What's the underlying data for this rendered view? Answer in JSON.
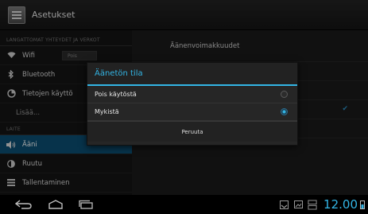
{
  "actionbar": {
    "title": "Asetukset"
  },
  "sidebar": {
    "section_wireless": "LANGATTOMAT YHTEYDET JA VERKOT",
    "items_wireless": [
      {
        "label": "Wifi",
        "icon": "wifi-icon",
        "toggle": "Pois"
      },
      {
        "label": "Bluetooth",
        "icon": "bluetooth-icon"
      },
      {
        "label": "Tietojen käyttö",
        "icon": "data-usage-icon"
      },
      {
        "label": "Lisää...",
        "icon": ""
      }
    ],
    "section_device": "LAITE",
    "items_device": [
      {
        "label": "Ääni",
        "icon": "sound-icon",
        "selected": true
      },
      {
        "label": "Ruutu",
        "icon": "display-icon"
      },
      {
        "label": "Tallentaminen",
        "icon": "storage-icon"
      }
    ]
  },
  "main": {
    "header": "Äänenvoimakkuudet"
  },
  "dialog": {
    "title": "Äänetön tila",
    "options": [
      {
        "label": "Pois käytöstä",
        "selected": false
      },
      {
        "label": "Mykistä",
        "selected": true
      }
    ],
    "cancel": "Peruuta"
  },
  "statusbar": {
    "time": "12.00"
  },
  "colors": {
    "accent": "#33b5e5",
    "selection": "#0b4f73"
  }
}
